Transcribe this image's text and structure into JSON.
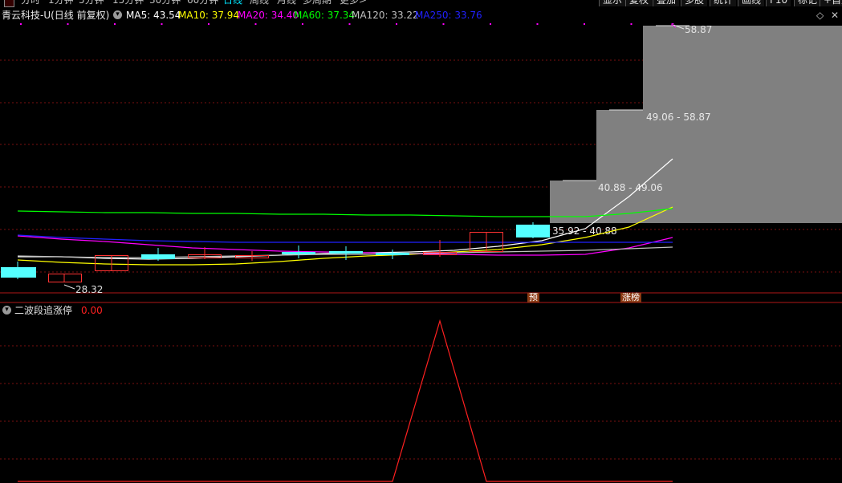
{
  "periods": [
    {
      "label": "分时",
      "active": false
    },
    {
      "label": "1分钟",
      "active": false
    },
    {
      "label": "5分钟",
      "active": false
    },
    {
      "label": "15分钟",
      "active": false
    },
    {
      "label": "30分钟",
      "active": false
    },
    {
      "label": "60分钟",
      "active": false
    },
    {
      "label": "日线",
      "active": true
    },
    {
      "label": "周线",
      "active": false
    },
    {
      "label": "月线",
      "active": false
    },
    {
      "label": "多周期",
      "active": false
    },
    {
      "label": "更多>",
      "active": false
    }
  ],
  "toolbar": [
    "显示",
    "复权",
    "叠加",
    "多股",
    "统计",
    "画线",
    "F10",
    "标记",
    "+自选"
  ],
  "info": {
    "title": "青云科技-U(日线 前复权)",
    "ma": [
      {
        "label": "MA5: 43.54",
        "color": "#ffffff"
      },
      {
        "label": "MA10: 37.94",
        "color": "#ffff00"
      },
      {
        "label": "MA20: 34.40",
        "color": "#ff00ff"
      },
      {
        "label": "MA60: 37.34",
        "color": "#00ff00"
      },
      {
        "label": "MA120: 33.22",
        "color": "#c0c0c0"
      },
      {
        "label": "MA250: 33.76",
        "color": "#2020ff"
      }
    ]
  },
  "indicator": {
    "name": "二波段追涨停",
    "value": "0.00"
  },
  "tags": {
    "pre": "预",
    "zt": "涨榜"
  },
  "chart_data": {
    "type": "candlestick",
    "price_ticks": [
      50,
      48,
      46,
      44,
      42,
      40,
      38,
      36,
      34,
      32,
      30,
      28,
      26
    ],
    "candles": [
      {
        "o": 29.6,
        "h": 30.6,
        "l": 28.9,
        "c": 30.2,
        "color": "cyan"
      },
      {
        "o": 28.9,
        "h": 29.3,
        "l": 28.32,
        "c": 28.3,
        "color": "red"
      },
      {
        "o": 30.4,
        "h": 31.2,
        "l": 29.4,
        "c": 29.7,
        "color": "red"
      },
      {
        "o": 31.0,
        "h": 31.6,
        "l": 30.8,
        "c": 31.2,
        "color": "cyan"
      },
      {
        "o": 31.0,
        "h": 31.8,
        "l": 30.8,
        "c": 31.3,
        "color": "red"
      },
      {
        "o": 31.1,
        "h": 31.6,
        "l": 30.8,
        "c": 31.1,
        "color": "red"
      },
      {
        "o": 31.3,
        "h": 31.8,
        "l": 30.9,
        "c": 31.4,
        "color": "cyan"
      },
      {
        "o": 31.4,
        "h": 31.8,
        "l": 31.0,
        "c": 31.5,
        "color": "cyan"
      },
      {
        "o": 31.1,
        "h": 31.6,
        "l": 31.0,
        "c": 31.5,
        "color": "cyan"
      },
      {
        "o": 31.4,
        "h": 32.8,
        "l": 31.2,
        "c": 31.6,
        "color": "red"
      },
      {
        "o": 31.3,
        "h": 33.0,
        "l": 31.2,
        "c": 33.0,
        "color": "red"
      },
      {
        "o": 32.5,
        "h": 34.0,
        "l": 32.0,
        "c": 33.7,
        "color": "cyan"
      }
    ],
    "ma_lines": [
      {
        "name": "MA5",
        "color": "#ffffff",
        "values": [
          30.0,
          30.0,
          30.0,
          30.2,
          30.4,
          30.7,
          31.0,
          31.2,
          31.3,
          31.4,
          31.9,
          33.0,
          35.5,
          38.5,
          40.5,
          43.54
        ]
      },
      {
        "name": "MA10",
        "color": "#ffff00",
        "values": [
          30.5,
          30.2,
          30.0,
          30.0,
          30.2,
          30.5,
          30.8,
          31.0,
          31.2,
          31.3,
          31.5,
          32.0,
          33.2,
          34.5,
          36.0,
          37.94
        ]
      },
      {
        "name": "MA20",
        "color": "#ff00ff",
        "values": [
          33.3,
          32.6,
          32.0,
          31.6,
          31.5,
          31.4,
          31.3,
          31.2,
          31.1,
          31.0,
          31.0,
          31.1,
          31.3,
          32.2,
          33.2,
          34.4
        ]
      },
      {
        "name": "MA60",
        "color": "#00ff00",
        "values": [
          36.3,
          36.2,
          36.2,
          36.1,
          36.0,
          35.9,
          35.9,
          35.9,
          35.8,
          35.8,
          35.8,
          35.8,
          35.8,
          36.0,
          36.8,
          37.34
        ]
      },
      {
        "name": "MA120",
        "color": "#c0c0c0",
        "values": [
          31.2,
          31.3,
          31.4,
          31.5,
          31.6,
          31.7,
          31.8,
          31.9,
          31.9,
          32.0,
          32.1,
          32.2,
          32.4,
          32.6,
          32.9,
          33.22
        ]
      },
      {
        "name": "MA250",
        "color": "#2020ff",
        "values": [
          33.5,
          33.3,
          33.1,
          33.0,
          32.9,
          32.8,
          32.8,
          32.9,
          33.0,
          33.1,
          33.2,
          33.3,
          33.4,
          33.5,
          33.6,
          33.76
        ]
      }
    ],
    "forecast_boxes": [
      {
        "lo": 35.92,
        "hi": 40.88,
        "label": "35.92 - 40.88"
      },
      {
        "lo": 40.88,
        "hi": 49.06,
        "label": "40.88 - 49.06"
      },
      {
        "lo": 49.06,
        "hi": 58.87,
        "label": "49.06 - 58.87"
      }
    ],
    "extremes": {
      "high_label": "58.87",
      "low_label": "28.32"
    },
    "indicator_series": {
      "name": "二波段追涨停",
      "x": [
        0,
        1,
        2,
        3,
        4,
        5,
        6,
        7,
        8,
        9,
        10,
        11,
        12
      ],
      "values": [
        0,
        0,
        0,
        0,
        0,
        0,
        0,
        0,
        0,
        1,
        0,
        0,
        0
      ]
    }
  }
}
